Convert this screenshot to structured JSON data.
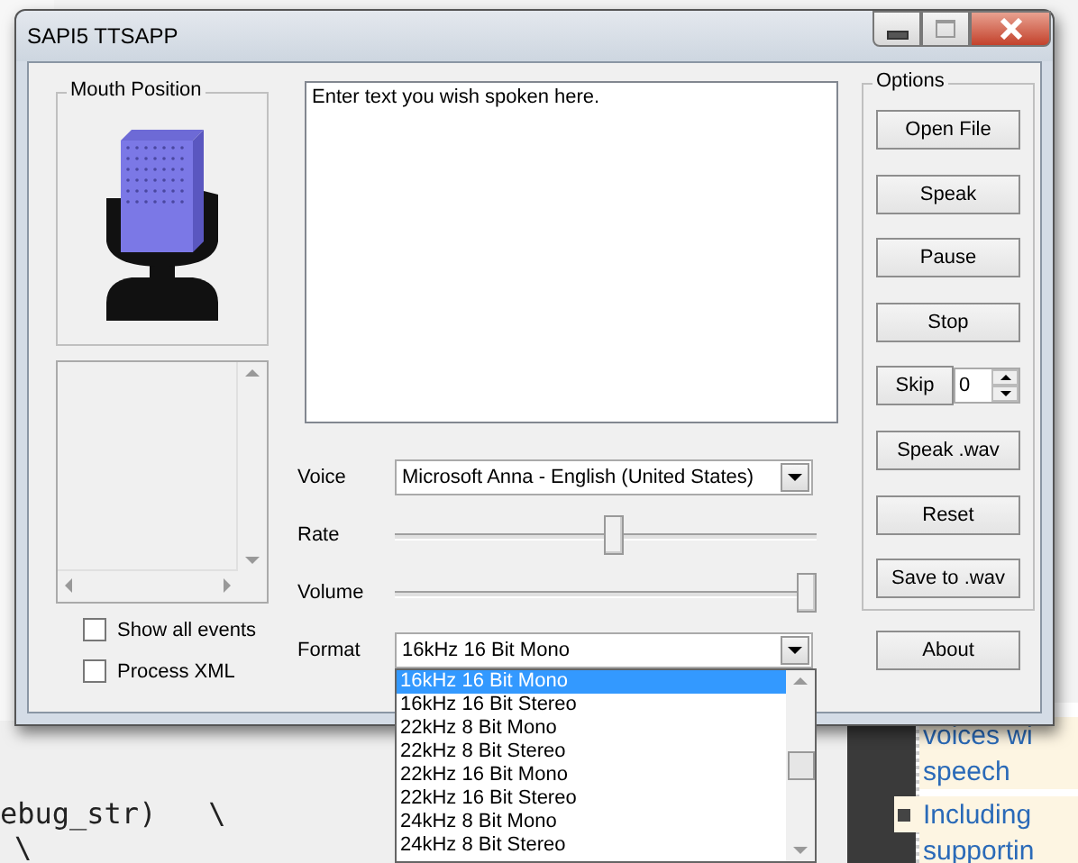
{
  "window": {
    "title": "SAPI5 TTSAPP"
  },
  "mouth_position": {
    "label": "Mouth Position"
  },
  "checkboxes": [
    {
      "label": "Show all events",
      "checked": false
    },
    {
      "label": "Process XML",
      "checked": false
    }
  ],
  "text_input": {
    "value": "Enter text you wish spoken here."
  },
  "voice": {
    "label": "Voice",
    "value": "Microsoft Anna - English (United States)"
  },
  "rate": {
    "label": "Rate",
    "level": 0.52
  },
  "volume": {
    "label": "Volume",
    "level": 1
  },
  "format": {
    "label": "Format",
    "value": "16kHz 16 Bit Mono",
    "options": [
      {
        "label": "16kHz 16 Bit Mono",
        "selected": true
      },
      {
        "label": "16kHz 16 Bit Stereo",
        "selected": false
      },
      {
        "label": "22kHz 8 Bit Mono",
        "selected": false
      },
      {
        "label": "22kHz 8 Bit Stereo",
        "selected": false
      },
      {
        "label": "22kHz 16 Bit Mono",
        "selected": false
      },
      {
        "label": "22kHz 16 Bit Stereo",
        "selected": false
      },
      {
        "label": "24kHz 8 Bit Mono",
        "selected": false
      },
      {
        "label": "24kHz 8 Bit Stereo",
        "selected": false
      }
    ]
  },
  "options": {
    "title": "Options",
    "buttons": [
      {
        "kind": "button",
        "label": "Open File"
      },
      {
        "kind": "button",
        "label": "Speak"
      },
      {
        "kind": "button",
        "label": "Pause"
      },
      {
        "kind": "button",
        "label": "Stop"
      },
      {
        "kind": "skip",
        "label": "Skip",
        "value": "0"
      },
      {
        "kind": "button",
        "label": "Speak .wav"
      },
      {
        "kind": "button",
        "label": "Reset"
      },
      {
        "kind": "button",
        "label": "Save to .wav"
      }
    ]
  },
  "about_button": {
    "label": "About"
  },
  "background": {
    "code_lines": [
      "ebug_str)   \\",
      "\\"
    ],
    "web_lines": [
      {
        "kind": "text",
        "text": "voices wi"
      },
      {
        "kind": "text",
        "text": "speech"
      },
      {
        "kind": "bullet",
        "text": "Including"
      },
      {
        "kind": "text",
        "text": "supportin"
      }
    ]
  }
}
